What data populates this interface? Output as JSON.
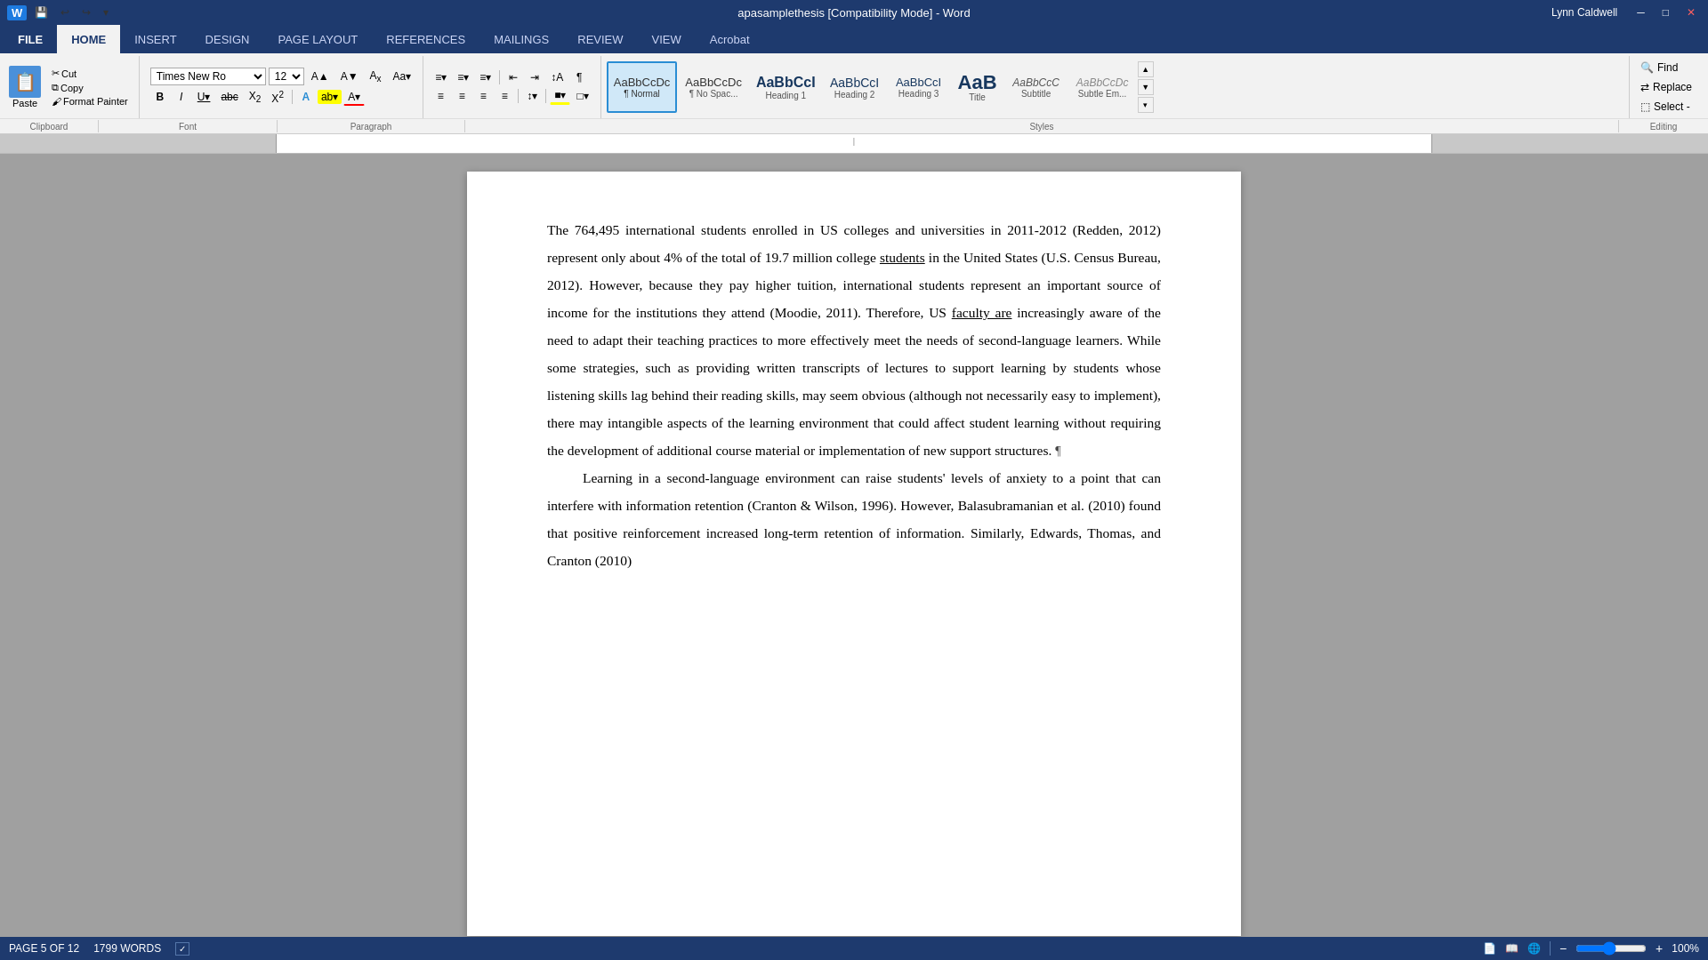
{
  "titlebar": {
    "title": "apasamplethesis [Compatibility Mode] - Word",
    "quick_access": [
      "save",
      "undo",
      "redo"
    ],
    "user": "Lynn Caldwell",
    "controls": [
      "minimize",
      "restore",
      "close"
    ]
  },
  "tabs": [
    {
      "id": "file",
      "label": "FILE"
    },
    {
      "id": "home",
      "label": "HOME",
      "active": true
    },
    {
      "id": "insert",
      "label": "INSERT"
    },
    {
      "id": "design",
      "label": "DESIGN"
    },
    {
      "id": "page_layout",
      "label": "PAGE LAYOUT"
    },
    {
      "id": "references",
      "label": "REFERENCES"
    },
    {
      "id": "mailings",
      "label": "MAILINGS"
    },
    {
      "id": "review",
      "label": "REVIEW"
    },
    {
      "id": "view",
      "label": "VIEW"
    },
    {
      "id": "acrobat",
      "label": "Acrobat"
    }
  ],
  "clipboard": {
    "paste_label": "Paste",
    "cut_label": "Cut",
    "copy_label": "Copy",
    "format_painter_label": "Format Painter"
  },
  "font": {
    "name": "Times New Ro",
    "size": "12",
    "bold": "B",
    "italic": "I",
    "underline": "U",
    "strikethrough": "abc",
    "subscript": "X₂",
    "superscript": "X²",
    "text_effects": "A",
    "highlight": "ab",
    "font_color": "A"
  },
  "paragraph": {
    "bullets": "≡",
    "numbering": "≡",
    "multilevel": "≡",
    "decrease_indent": "←",
    "increase_indent": "→",
    "sort": "↕",
    "show_formatting": "¶",
    "align_left": "≡",
    "align_center": "≡",
    "align_right": "≡",
    "justify": "≡",
    "line_spacing": "↕",
    "shading": "■",
    "borders": "□"
  },
  "styles": [
    {
      "id": "normal",
      "preview": "AaBbCcDc",
      "label": "¶ Normal",
      "active": true
    },
    {
      "id": "no_spacing",
      "preview": "AaBbCcDc",
      "label": "¶ No Spac..."
    },
    {
      "id": "heading1",
      "preview": "AaBbCcI",
      "label": "Heading 1"
    },
    {
      "id": "heading2",
      "preview": "AaBbCcI",
      "label": "Heading 2"
    },
    {
      "id": "heading3",
      "preview": "AaBbCcI",
      "label": "Heading 3"
    },
    {
      "id": "title",
      "preview": "AaB",
      "label": "Title"
    },
    {
      "id": "subtitle",
      "preview": "AaBbCcC",
      "label": "Subtitle"
    },
    {
      "id": "subtle_em",
      "preview": "AaBbCcDc",
      "label": "Subtle Em..."
    }
  ],
  "editing": {
    "find_label": "Find",
    "replace_label": "Replace",
    "select_label": "Select -"
  },
  "groups": {
    "clipboard": "Clipboard",
    "font": "Font",
    "paragraph": "Paragraph",
    "styles": "Styles",
    "editing": "Editing"
  },
  "document": {
    "paragraphs": [
      {
        "id": "p1",
        "text": "The 764,495 international students enrolled in US colleges and universities in 2011-2012 (Redden, 2012) represent only about 4% of the total of 19.7 million college students in the United States (U.S. Census Bureau, 2012). However, because they pay higher tuition, international students represent an important source of income for the institutions they attend (Moodie, 2011). Therefore, US faculty are increasingly aware of the need to adapt their teaching practices to more effectively meet the needs of second-language learners. While some strategies, such as providing written transcripts of lectures to support learning by students whose listening skills lag behind their reading skills, may seem obvious (although not necessarily easy to implement), there may intangible aspects of the learning environment that could affect student learning without requiring the development of additional course material or implementation of new support structures. ¶",
        "underlined_words": [
          "students",
          "faculty are"
        ],
        "indent": false
      },
      {
        "id": "p2",
        "text": "Learning in a second-language environment can raise students' levels of anxiety to a point that can interfere with information retention (Cranton & Wilson, 1996). However, Balasubramanian et al. (2010) found that positive reinforcement increased long-term retention of information. Similarly, Edwards, Thomas, and Cranton (2010)",
        "indent": true
      }
    ]
  },
  "statusbar": {
    "page_info": "PAGE 5 OF 12",
    "word_count": "1799 WORDS",
    "view_icons": [
      "print",
      "full_reading",
      "web",
      "outline",
      "draft"
    ],
    "zoom_level": "100%"
  }
}
